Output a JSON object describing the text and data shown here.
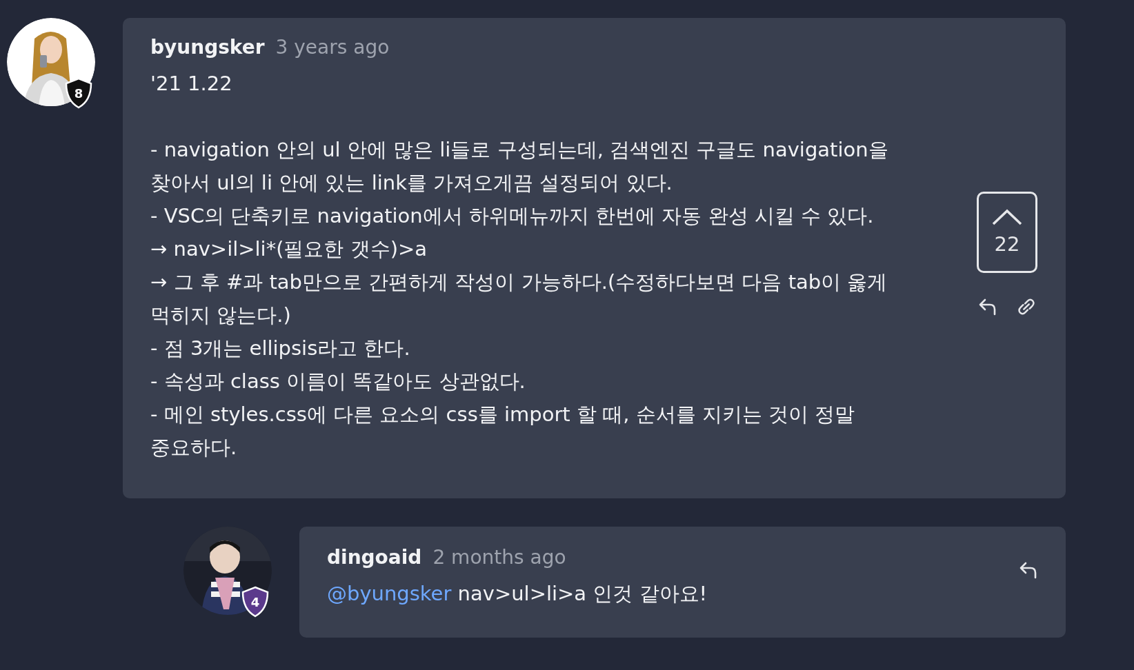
{
  "comment": {
    "badge": {
      "level": "8",
      "color": "#111111"
    },
    "author": "byungsker",
    "time": "3 years ago",
    "date_line": "'21 1.22",
    "lines": [
      "- navigation 안의 ul 안에 많은 li들로 구성되는데, 검색엔진 구글도 navigation을 찾아서 ul의 li 안에 있는 link를 가져오게끔 설정되어 있다.",
      "- VSC의 단축키로 navigation에서 하위메뉴까지 한번에 자동 완성 시킬 수 있다.",
      "→ nav>il>li*(필요한 갯수)>a",
      "→ 그 후 #과 tab만으로 간편하게 작성이 가능하다.(수정하다보면 다음 tab이 옳게 먹히지 않는다.)",
      "- 점 3개는 ellipsis라고 한다.",
      "- 속성과 class 이름이 똑같아도 상관없다.",
      "- 메인 styles.css에 다른 요소의 css를 import 할 때, 순서를 지키는 것이 정말 중요하다."
    ],
    "votes": "22"
  },
  "reply": {
    "badge": {
      "level": "4",
      "color": "#5b3a8c"
    },
    "author": "dingoaid",
    "time": "2 months ago",
    "mention": "@byungsker",
    "text": "nav>ul>li>a 인것 같아요!"
  }
}
